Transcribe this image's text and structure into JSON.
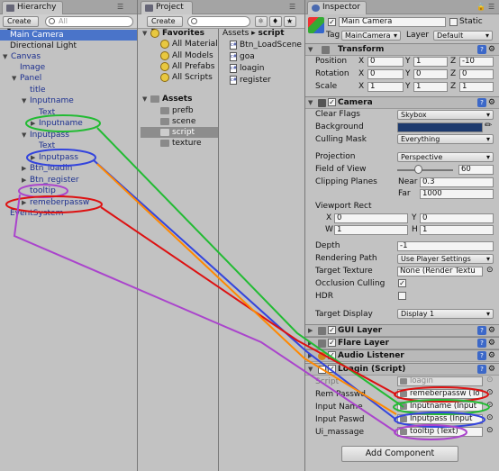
{
  "hierarchy": {
    "tab_label": "Hierarchy",
    "create_label": "Create",
    "search_placeholder": "All",
    "items": [
      {
        "label": "Main Camera"
      },
      {
        "label": "Directional Light"
      },
      {
        "label": "Canvas"
      },
      {
        "label": "Image"
      },
      {
        "label": "Panel"
      },
      {
        "label": "title"
      },
      {
        "label": "Inputname"
      },
      {
        "label": "Text"
      },
      {
        "label": "Inputname"
      },
      {
        "label": "Inputpass"
      },
      {
        "label": "Text"
      },
      {
        "label": "Inputpass"
      },
      {
        "label": "Btn_loadin"
      },
      {
        "label": "Btn_register"
      },
      {
        "label": "tooltip"
      },
      {
        "label": "remeberpassw"
      },
      {
        "label": "EventSystem"
      }
    ]
  },
  "project": {
    "tab_label": "Project",
    "create_label": "Create",
    "favorites_label": "Favorites",
    "favorites": [
      "All Material",
      "All Models",
      "All Prefabs",
      "All Scripts"
    ],
    "assets_label": "Assets",
    "folders": [
      "prefb",
      "scene",
      "script",
      "texture"
    ],
    "breadcrumb": [
      "Assets",
      "script"
    ],
    "files": [
      "Btn_LoadScene",
      "goa",
      "loagin",
      "register"
    ]
  },
  "inspector": {
    "tab_label": "Inspector",
    "object_name": "Main Camera",
    "static_label": "Static",
    "tag_label": "Tag",
    "tag_value": "MainCamera",
    "layer_label": "Layer",
    "layer_value": "Default",
    "transform": {
      "title": "Transform",
      "position_label": "Position",
      "rotation_label": "Rotation",
      "scale_label": "Scale",
      "position": [
        "0",
        "1",
        "-10"
      ],
      "rotation": [
        "0",
        "0",
        "0"
      ],
      "scale": [
        "1",
        "1",
        "1"
      ]
    },
    "camera": {
      "title": "Camera",
      "clear_flags_label": "Clear Flags",
      "clear_flags": "Skybox",
      "background_label": "Background",
      "culling_mask_label": "Culling Mask",
      "culling_mask": "Everything",
      "projection_label": "Projection",
      "projection": "Perspective",
      "fov_label": "Field of View",
      "fov": "60",
      "clipping_label": "Clipping Planes",
      "near_label": "Near",
      "near": "0.3",
      "far_label": "Far",
      "far": "1000",
      "viewport_label": "Viewport Rect",
      "vx": "0",
      "vy": "0",
      "vw": "1",
      "vh": "1",
      "depth_label": "Depth",
      "depth": "-1",
      "rendering_path_label": "Rendering Path",
      "rendering_path": "Use Player Settings",
      "target_texture_label": "Target Texture",
      "target_texture": "None (Render Textu",
      "occlusion_label": "Occlusion Culling",
      "hdr_label": "HDR",
      "target_display_label": "Target Display",
      "target_display": "Display 1"
    },
    "gui_layer": "GUI Layer",
    "flare_layer": "Flare Layer",
    "audio_listener": "Audio Listener",
    "loagin": {
      "title": "Loagin (Script)",
      "script_label": "Script",
      "script_value": "loagin",
      "rem_label": "Rem Passwd",
      "rem_value": "remeberpassw (To",
      "name_label": "Input Name",
      "name_value": "Inputname (Input",
      "pass_label": "Input Paswd",
      "pass_value": "Inputpass (Input",
      "msg_label": "Ui_massage",
      "msg_value": "tooltip (Text)"
    },
    "add_component": "Add Component",
    "colors": {
      "background_swatch": "#1d3a6e"
    }
  },
  "annotation_colors": {
    "green": "#22bb33",
    "blue": "#3344dd",
    "red": "#dd1111",
    "purple": "#aa44cc",
    "orange": "#ff8800"
  }
}
